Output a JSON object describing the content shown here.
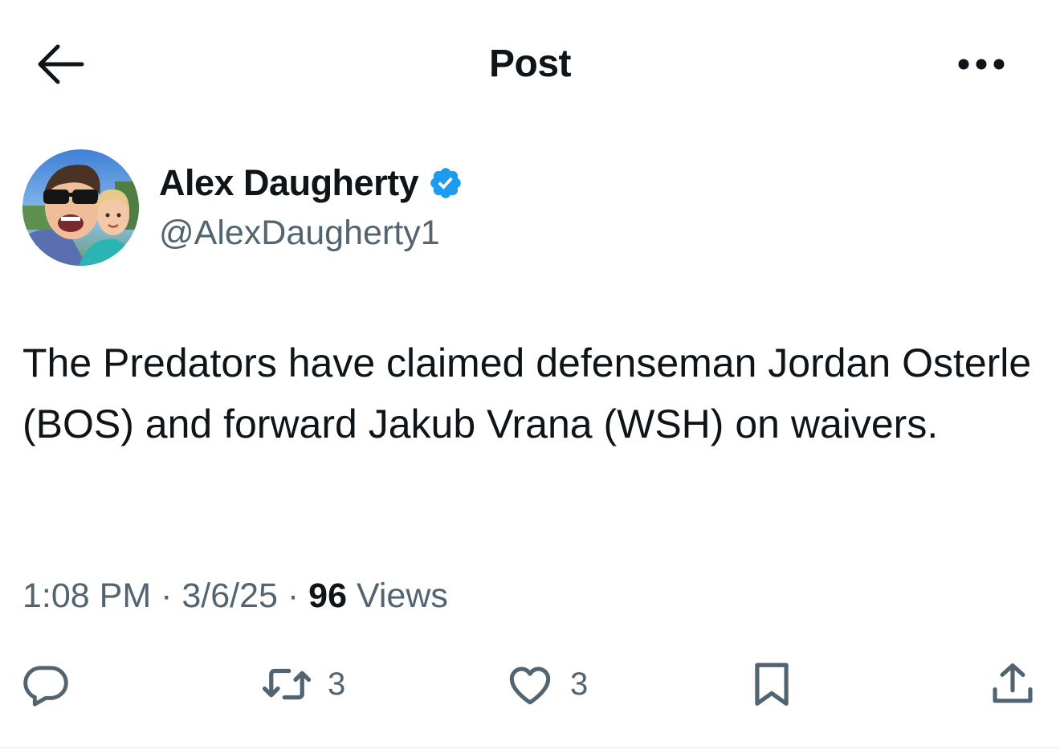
{
  "header": {
    "title": "Post",
    "back_icon": "arrow-left-icon",
    "more_icon": "more-horizontal-icon"
  },
  "author": {
    "name": "Alex Daugherty",
    "handle": "@AlexDaugherty1",
    "verified": true,
    "verified_color": "#1d9bf0"
  },
  "tweet": {
    "text": "The Predators have claimed defenseman Jordan Osterle (BOS) and forward Jakub Vrana (WSH) on waivers."
  },
  "meta": {
    "time": "1:08 PM",
    "separator": "·",
    "date": "3/6/25",
    "views_count": "96",
    "views_label": "Views"
  },
  "actions": {
    "reply_icon": "reply-icon",
    "retweet_icon": "retweet-icon",
    "retweet_count": "3",
    "like_icon": "heart-icon",
    "like_count": "3",
    "bookmark_icon": "bookmark-icon",
    "share_icon": "share-icon"
  },
  "colors": {
    "text_primary": "#0f1419",
    "text_secondary": "#536471",
    "accent": "#1d9bf0"
  }
}
